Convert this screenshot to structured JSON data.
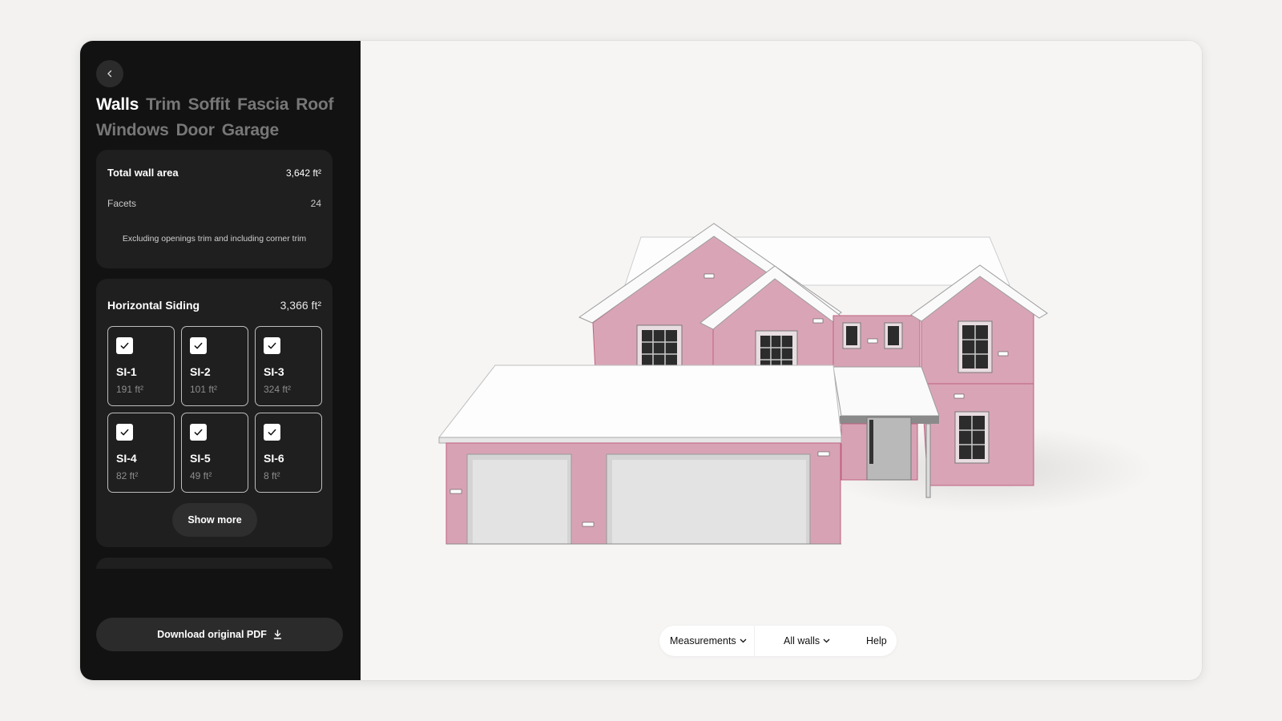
{
  "sidebar": {
    "tabs": [
      {
        "label": "Walls",
        "active": true
      },
      {
        "label": "Trim",
        "active": false
      },
      {
        "label": "Soffit",
        "active": false
      },
      {
        "label": "Fascia",
        "active": false
      },
      {
        "label": "Roof",
        "active": false
      },
      {
        "label": "Windows",
        "active": false
      },
      {
        "label": "Door",
        "active": false
      },
      {
        "label": "Garage",
        "active": false
      }
    ],
    "summary": {
      "total_label": "Total wall area",
      "total_value": "3,642 ft²",
      "facets_label": "Facets",
      "facets_value": "24",
      "note": "Excluding openings trim and including corner trim"
    },
    "siding": {
      "title": "Horizontal Siding",
      "total": "3,366 ft²",
      "items": [
        {
          "name": "SI-1",
          "area": "191 ft²",
          "checked": true
        },
        {
          "name": "SI-2",
          "area": "101 ft²",
          "checked": true
        },
        {
          "name": "SI-3",
          "area": "324 ft²",
          "checked": true
        },
        {
          "name": "SI-4",
          "area": "82 ft²",
          "checked": true
        },
        {
          "name": "SI-5",
          "area": "49 ft²",
          "checked": true
        },
        {
          "name": "SI-6",
          "area": "8 ft²",
          "checked": true
        }
      ],
      "show_more": "Show more"
    },
    "download_label": "Download original PDF"
  },
  "toolbar": {
    "measurements": "Measurements",
    "walls": "All walls",
    "help": "Help"
  },
  "colors": {
    "sidebar_bg": "#121212",
    "card_bg": "#1f1f1f",
    "wall_highlight": "#d8a8b8",
    "roof": "#ffffff"
  }
}
